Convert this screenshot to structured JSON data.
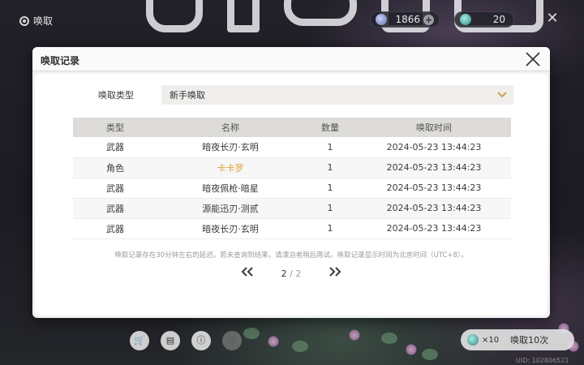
{
  "page": {
    "title": "唤取",
    "uid": "UID: 102806521"
  },
  "currencies": [
    {
      "value": "1866",
      "icon": "star-currency-icon"
    },
    {
      "value": "20",
      "icon": "ticket-currency-icon"
    }
  ],
  "modal": {
    "title": "唤取记录",
    "type_label": "唤取类型",
    "type_value": "新手唤取",
    "columns": [
      "类型",
      "名称",
      "数量",
      "唤取时间"
    ],
    "rows": [
      {
        "type": "武器",
        "name": "暗夜长刃·玄明",
        "qty": "1",
        "time": "2024-05-23 13:44:23",
        "highlight": false
      },
      {
        "type": "角色",
        "name": "卡卡罗",
        "qty": "1",
        "time": "2024-05-23 13:44:23",
        "highlight": true
      },
      {
        "type": "武器",
        "name": "暗夜佩枪·暗星",
        "qty": "1",
        "time": "2024-05-23 13:44:23",
        "highlight": false
      },
      {
        "type": "武器",
        "name": "源能迅刃·测贰",
        "qty": "1",
        "time": "2024-05-23 13:44:23",
        "highlight": false
      },
      {
        "type": "武器",
        "name": "暗夜长刃·玄明",
        "qty": "1",
        "time": "2024-05-23 13:44:23",
        "highlight": false
      }
    ],
    "notice": "唤取记录存在30分钟左右的延迟。若未查询到结果，请漂泊者稍后再试。唤取记录显示时间为北京时间（UTC+8）。",
    "pager": {
      "current": "2",
      "separator": "/",
      "total": "2"
    }
  },
  "bottom": {
    "pull_count": "×10",
    "pull_label": "唤取10次"
  },
  "colors": {
    "highlight": "#e0a23c",
    "accent_arrow": "#c9a64e"
  }
}
